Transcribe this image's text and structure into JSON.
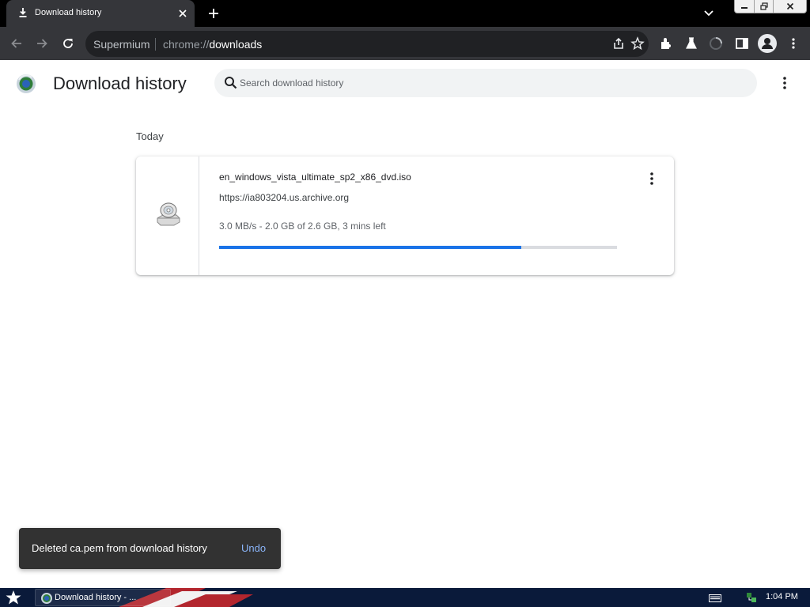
{
  "tab": {
    "title": "Download history",
    "favicon": "download-icon"
  },
  "window_controls": [
    "minimize-icon",
    "restore-icon",
    "close-icon"
  ],
  "omnibox": {
    "brand": "Supermium",
    "scheme": "chrome://",
    "host": "downloads"
  },
  "toolbar_icons": [
    "back-icon",
    "forward-icon",
    "reload-icon",
    "share-icon",
    "star-icon",
    "extensions-icon",
    "labs-icon",
    "loading-icon",
    "side-panel-icon",
    "profile-icon",
    "menu-icon"
  ],
  "header": {
    "title": "Download history",
    "search_placeholder": "Search download history"
  },
  "downloads": {
    "section_date": "Today",
    "items": [
      {
        "file_name": "en_windows_vista_ultimate_sp2_x86_dvd.iso",
        "url": "https://ia803204.us.archive.org",
        "status": "3.0 MB/s - 2.0 GB of 2.6 GB, 3 mins left",
        "progress_fraction": 0.76,
        "icon": "disc-drive-icon"
      }
    ]
  },
  "toast": {
    "message": "Deleted ca.pem from download history",
    "action": "Undo"
  },
  "taskbar": {
    "task_label": "Download history - ...",
    "clock": "1:04 PM"
  },
  "colors": {
    "accent": "#1a73e8",
    "toolbar": "#35363a",
    "tabstrip": "#000000",
    "toast_bg": "#323232",
    "toast_action": "#8ab4f8"
  }
}
